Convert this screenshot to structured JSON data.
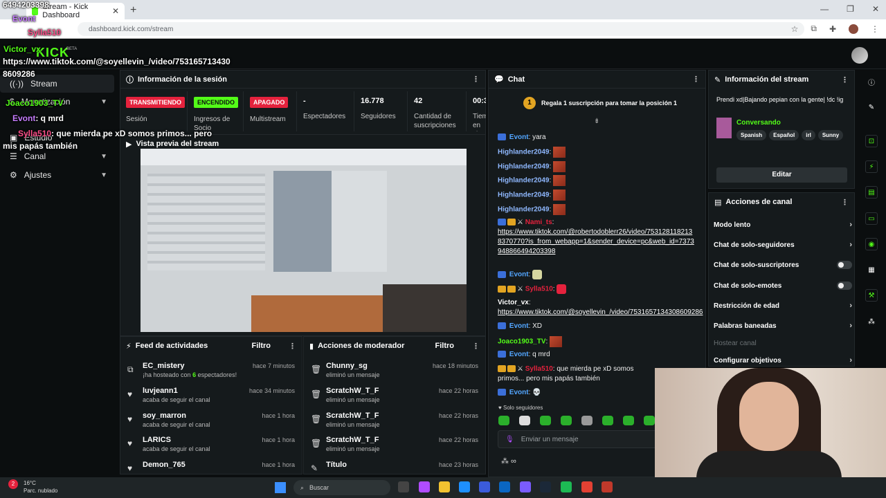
{
  "browser": {
    "tab_title": "Stream - Kick Dashboard",
    "url": "dashboard.kick.com/stream",
    "new_tab": "+",
    "close": "✕"
  },
  "brand": {
    "logo": "KICK",
    "beta": "BETA"
  },
  "sidebar": {
    "items": [
      {
        "label": "Stream",
        "icon": "broadcast-icon"
      },
      {
        "label": "Monetización",
        "icon": "money-icon"
      },
      {
        "label": "Estudio",
        "icon": "studio-icon"
      },
      {
        "label": "Canal",
        "icon": "channel-icon"
      },
      {
        "label": "Ajustes",
        "icon": "gear-icon"
      }
    ]
  },
  "session": {
    "title": "Información de la sesión",
    "stats": [
      {
        "pill": "TRANSMITIENDO",
        "label": "Sesión"
      },
      {
        "pill": "ENCENDIDO",
        "label": "Ingresos de Socio"
      },
      {
        "pill": "APAGADO",
        "label": "Multistream"
      },
      {
        "value": "-",
        "label": "Espectadores"
      },
      {
        "value": "16.778",
        "label": "Seguidores"
      },
      {
        "value": "42",
        "label": "Cantidad de suscripciones"
      },
      {
        "value": "00:3",
        "label": "Tiem en vi"
      }
    ]
  },
  "preview": {
    "title": "Vista previa del stream"
  },
  "feed": {
    "title": "Feed de actividades",
    "filter": "Filtro",
    "items": [
      {
        "name": "EC_mistery",
        "sub_pre": "¡ha hosteado con ",
        "sub_num": "6",
        "sub_post": " espectadores!",
        "time": "hace 7 minutos",
        "icon": "host-icon"
      },
      {
        "name": "luvjeann1",
        "sub": "acaba de seguir el canal",
        "time": "hace 34 minutos",
        "icon": "heart-icon"
      },
      {
        "name": "soy_marron",
        "sub": "acaba de seguir el canal",
        "time": "hace 1 hora",
        "icon": "heart-icon"
      },
      {
        "name": "LARICS",
        "sub": "acaba de seguir el canal",
        "time": "hace 1 hora",
        "icon": "heart-icon"
      },
      {
        "name": "Demon_765",
        "sub": "",
        "time": "hace 1 hora",
        "icon": "heart-icon"
      }
    ]
  },
  "mod": {
    "title": "Acciones de moderador",
    "filter": "Filtro",
    "items": [
      {
        "name": "Chunny_sg",
        "sub": "eliminó un mensaje",
        "time": "hace 18 minutos"
      },
      {
        "name": "ScratchW_T_F",
        "sub": "eliminó un mensaje",
        "time": "hace 22 horas"
      },
      {
        "name": "ScratchW_T_F",
        "sub": "eliminó un mensaje",
        "time": "hace 22 horas"
      },
      {
        "name": "ScratchW_T_F",
        "sub": "eliminó un mensaje",
        "time": "hace 22 horas"
      },
      {
        "name": "Título",
        "sub": "",
        "time": "hace 23 horas"
      }
    ]
  },
  "chat": {
    "title": "Chat",
    "pinned_rank": "1",
    "pinned": "Regala 1 suscripción para tomar la posición 1",
    "messages": [
      {
        "user": "Evont",
        "text": " yara",
        "color": "#53a6ff"
      },
      {
        "user": "Highlander2049",
        "text": "",
        "color": "#8fb8ff"
      },
      {
        "user": "Highlander2049",
        "text": "",
        "color": "#8fb8ff"
      },
      {
        "user": "Highlander2049",
        "text": "",
        "color": "#8fb8ff"
      },
      {
        "user": "Highlander2049",
        "text": "",
        "color": "#8fb8ff"
      },
      {
        "user": "Highlander2049",
        "text": "",
        "color": "#8fb8ff"
      },
      {
        "user": "Nami_ts",
        "text": "",
        "color": "#e5223d"
      },
      {
        "link": "https://www.tiktok.com/@robertodoblerr26/video/7531281182138370770?is_from_webapp=1&sender_device=pc&web_id=7373948866494203398"
      },
      {
        "user": "Evont",
        "text": "",
        "color": "#53a6ff"
      },
      {
        "user": "Sylla510",
        "text": "",
        "color": "#e5223d"
      },
      {
        "user": "Victor_vx",
        "text": "",
        "color": "#ffffff"
      },
      {
        "link": "https://www.tiktok.com/@soyellevin_/video/7531657134308609286"
      },
      {
        "user": "Evont",
        "text": " XD",
        "color": "#53a6ff"
      },
      {
        "user": "Joaco1903_TV",
        "text": "",
        "color": "#53fc18"
      },
      {
        "user": "Evont",
        "text": " q mrd",
        "color": "#53a6ff"
      },
      {
        "user": "Sylla510",
        "text": " que mierda pe xD somos primos... pero mis papás también",
        "color": "#e5223d"
      },
      {
        "user": "Evont",
        "text": "",
        "color": "#53a6ff"
      }
    ],
    "followers_only": "Solo seguidores",
    "input_placeholder": "Enviar un mensaje"
  },
  "stream_info": {
    "title": "Información del stream",
    "stream_title": "Prendi xd|Bajando pepian con la gente| !dc !ig",
    "category": "Conversando",
    "tags": [
      "Spanish",
      "Español",
      "irl",
      "Sunny"
    ],
    "edit": "Editar"
  },
  "channel_actions": {
    "title": "Acciones de canal",
    "items": [
      {
        "label": "Modo lento",
        "kind": "arrow"
      },
      {
        "label": "Chat de solo-seguidores",
        "kind": "arrow"
      },
      {
        "label": "Chat de solo-suscriptores",
        "kind": "toggle"
      },
      {
        "label": "Chat de solo-emotes",
        "kind": "toggle"
      },
      {
        "label": "Restricción de edad",
        "kind": "arrow"
      },
      {
        "label": "Palabras baneadas",
        "kind": "arrow"
      },
      {
        "label": "Hostear canal",
        "kind": "disabled"
      },
      {
        "label": "Configurar objetivos",
        "kind": "arrow"
      }
    ]
  },
  "overlay": {
    "top_num": "6494203398",
    "evont": "Evont",
    "sylla": "Sylla510",
    "victor": "Victor_vx",
    "link_line1": "https://www.tiktok.com/@soyellevin_/video/753165713430",
    "link_line2": "8609286",
    "joaco": "Joaco1903_TV",
    "evont_qmrd_user": "Evont",
    "evont_qmrd": ": q mrd",
    "sylla_msg": ": que mierda pe xD somos primos... pero",
    "sylla_msg2": "mis papás también"
  },
  "taskbar": {
    "temp": "16°C",
    "weather": "Parc. nublado",
    "search": "Buscar",
    "notif": "2"
  },
  "colors": {
    "accent": "#53fc18",
    "live_red": "#e5223d",
    "bg": "#0b0e0f",
    "panel": "#151a1c"
  }
}
